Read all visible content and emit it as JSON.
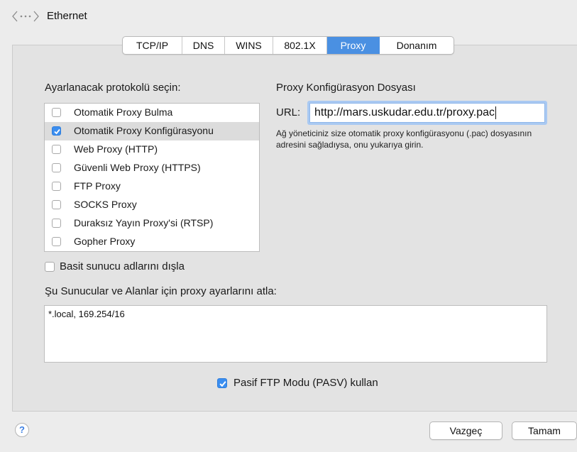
{
  "header": {
    "title": "Ethernet",
    "back_icon": "network-back-icon"
  },
  "tabs": [
    {
      "label": "TCP/IP"
    },
    {
      "label": "DNS"
    },
    {
      "label": "WINS"
    },
    {
      "label": "802.1X"
    },
    {
      "label": "Proxy",
      "active": true
    },
    {
      "label": "Donanım"
    }
  ],
  "protocols": {
    "heading": "Ayarlanacak protokolü seçin:",
    "items": [
      {
        "label": "Otomatik Proxy Bulma",
        "checked": false
      },
      {
        "label": "Otomatik Proxy Konfigürasyonu",
        "checked": true,
        "selected": true
      },
      {
        "label": "Web Proxy (HTTP)",
        "checked": false
      },
      {
        "label": "Güvenli Web Proxy (HTTPS)",
        "checked": false
      },
      {
        "label": "FTP Proxy",
        "checked": false
      },
      {
        "label": "SOCKS Proxy",
        "checked": false
      },
      {
        "label": "Duraksız Yayın Proxy'si (RTSP)",
        "checked": false
      },
      {
        "label": "Gopher Proxy",
        "checked": false
      }
    ]
  },
  "pac": {
    "heading": "Proxy Konfigürasyon Dosyası",
    "url_label": "URL:",
    "url_value": "http://mars.uskudar.edu.tr/proxy.pac",
    "help_text": "Ağ yöneticiniz size otomatik proxy konfigürasyonu (.pac) dosyasının adresini sağladıysa, onu yukarıya girin."
  },
  "exclude_simple": {
    "label": "Basit sunucu adlarını dışla",
    "checked": false
  },
  "bypass": {
    "label": "Şu Sunucular ve Alanlar için proxy ayarlarını atla:",
    "value": "*.local, 169.254/16"
  },
  "pasv": {
    "label": "Pasif FTP Modu (PASV) kullan",
    "checked": true
  },
  "footer": {
    "help": "?",
    "cancel": "Vazgeç",
    "ok": "Tamam"
  },
  "colors": {
    "accent": "#4a90e2",
    "checkbox": "#3b8ef0",
    "background": "#ececec"
  }
}
